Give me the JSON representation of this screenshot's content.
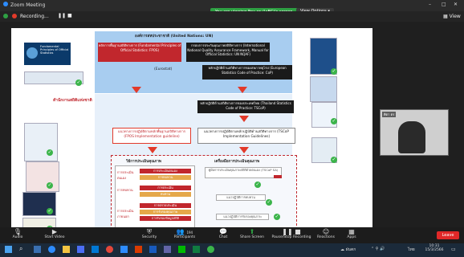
{
  "window": {
    "title": "Zoom Meeting"
  },
  "recording": {
    "label": "Recording..."
  },
  "share_banner": {
    "text": "You are viewing ศิตา ตร (IaBC)'s screen"
  },
  "view_options": {
    "label": "View Options"
  },
  "top_right": {
    "view_label": "View"
  },
  "slide": {
    "un_header": "องค์การสหประชาชาติ (United Nations: UN)",
    "fund_principles_text": "Fundamental Principles of Official Statistics",
    "fpos_box": "หลักการพื้นฐานสถิติทางการ (Fundamental Principles of Official Statistics: FPOS)",
    "ngqaf_box": "กรอบการประกันคุณภาพสถิติทางการ (International National Quality Assurance Framework, Manual for Official Statistics: UN NQAF)",
    "eu_code_box": "หลักปฏิบัติด้านสถิติทางการของสหภาพยุโรป (European Statistics Code of Practice: CoP)",
    "eurostat": "(Eurostat)",
    "nso_label": "สำนักงานสถิติแห่งชาติ",
    "tscop_box": "หลักปฏิบัติด้านสถิติทางการของประเทศไทย (Thailand Statistics Code of Practice: TSCoP)",
    "guideline_fpos": "แนวทางการปฏิบัติตามหลักพื้นฐานสถิติทางการ (FPOS Implementation guideline)",
    "guideline_tscop": "แนวทางการปฏิบัติตามหลักปฏิบัติด้านสถิติทางการ (TSCoP Implementation Guidelines)",
    "left_column_title": "วิธีการประเมินคุณภาพ",
    "right_column_title": "เครื่องมือการประเมินคุณภาพ",
    "rows": [
      {
        "label": "การประเมิน ตนเอง",
        "items": [
          "การประเมินตนเอง",
          "การทบทวน"
        ],
        "tool": "คู่มือการประเมินคุณภาพสถิติด้วยตนเอง (TSCoP SA)"
      },
      {
        "label": "การทบทวน",
        "items": [
          "การประเมิน",
          "ทบทวน"
        ],
        "tool": "แนวปฏิบัติการทบทวน"
      },
      {
        "label": "การประเมิน ภายนอก",
        "items": [
          "การตรวจประเมิน",
          "การรับรองคุณภาพ",
          "การรับรองข้อมูลสถิติ"
        ],
        "tool": "แนวปฏิบัติการรับรองคุณภาพ"
      }
    ]
  },
  "gallery": {
    "participant_name": "ศิตา ตร"
  },
  "toolbar": {
    "items": [
      {
        "label": "Audio",
        "icon": "mic-icon"
      },
      {
        "label": "Start Video",
        "icon": "video-icon"
      },
      {
        "label": "Security",
        "icon": "shield-icon"
      },
      {
        "label": "Participants",
        "icon": "people-icon",
        "count": "194"
      },
      {
        "label": "Chat",
        "icon": "chat-icon"
      },
      {
        "label": "Share Screen",
        "icon": "share-icon"
      },
      {
        "label": "Pause/Stop Recording",
        "icon": "pause-icon"
      },
      {
        "label": "Reactions",
        "icon": "reactions-icon"
      },
      {
        "label": "Apps",
        "icon": "apps-icon"
      }
    ],
    "leave_label": "Leave"
  },
  "taskbar": {
    "weather": "ฝนตก",
    "lang": "ไทย",
    "time": "10:31",
    "date": "15/3/2566"
  },
  "colors": {
    "accent_red": "#c1272d",
    "share_green": "#2ea043",
    "slide_blue": "#a8cdf0"
  }
}
